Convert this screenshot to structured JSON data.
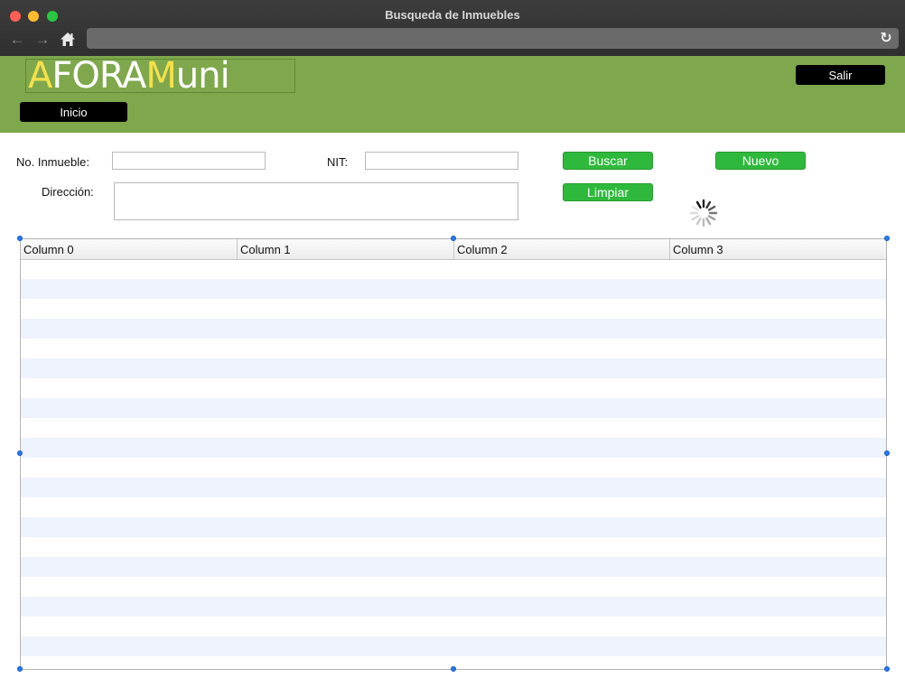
{
  "window": {
    "title": "Busqueda de Inmuebles"
  },
  "browser": {
    "back_icon": "←",
    "forward_icon": "→",
    "home_icon": "⌂",
    "reload_icon": "↻",
    "url": ""
  },
  "header": {
    "logo_parts": [
      "A",
      "FORA",
      "M",
      "uni"
    ],
    "salir_label": "Salir",
    "inicio_label": "Inicio",
    "background_color": "#7ea84b"
  },
  "form": {
    "no_inmueble_label": "No. Inmueble:",
    "no_inmueble_value": "",
    "nit_label": "NIT:",
    "nit_value": "",
    "direccion_label": "Dirección:",
    "direccion_value": "",
    "buscar_label": "Buscar",
    "nuevo_label": "Nuevo",
    "limpiar_label": "Limpiar",
    "button_color": "#2fb93c"
  },
  "table": {
    "columns": [
      "Column 0",
      "Column 1",
      "Column 2",
      "Column 3"
    ],
    "stripe_color": "#eef3fc"
  }
}
